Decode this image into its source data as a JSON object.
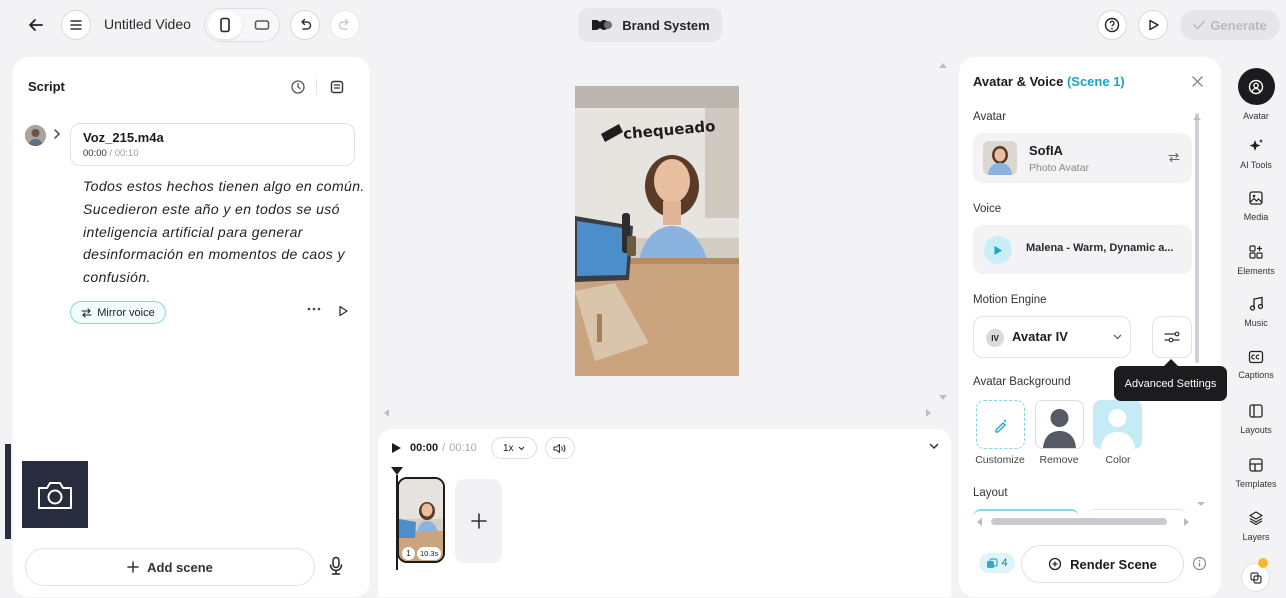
{
  "header": {
    "title": "Untitled Video",
    "brand_label": "Brand System",
    "generate_label": "Generate"
  },
  "script": {
    "title": "Script",
    "audio": {
      "name": "Voz_215.m4a",
      "current": "00:00",
      "duration": "00:10"
    },
    "text": "Todos estos hechos tienen algo en común. Sucedieron este año y en todos se usó inteligencia artificial para generar desinformación en momentos de caos y confusión.",
    "mirror_voice_label": "Mirror voice",
    "add_scene_label": "Add scene"
  },
  "timeline": {
    "current": "00:00",
    "separator": "/",
    "duration": "00:10",
    "speed": "1x",
    "clip_index": "1",
    "clip_duration": "10.3s"
  },
  "panel": {
    "title": "Avatar & Voice",
    "scene": "(Scene 1)",
    "avatar_label": "Avatar",
    "avatar_name": "SofIA",
    "avatar_type": "Photo Avatar",
    "voice_label": "Voice",
    "voice_name": "Malena - Warm, Dynamic a...",
    "engine_label": "Motion Engine",
    "engine_badge": "IV",
    "engine_value": "Avatar IV",
    "tooltip": "Advanced Settings",
    "background_label": "Avatar Background",
    "bg_options": [
      "Customize",
      "Remove",
      "Color"
    ],
    "layout_label": "Layout",
    "credits": "4",
    "render_label": "Render Scene"
  },
  "toolbar": [
    "Avatar",
    "AI Tools",
    "Media",
    "Elements",
    "Music",
    "Captions",
    "Layouts",
    "Templates",
    "Layers"
  ],
  "video": {
    "brand_text": "chequeado"
  },
  "colors": {
    "accent": "#1fc3e0",
    "dark": "#1c1c1f",
    "tooltip": "#1c1c1f"
  }
}
